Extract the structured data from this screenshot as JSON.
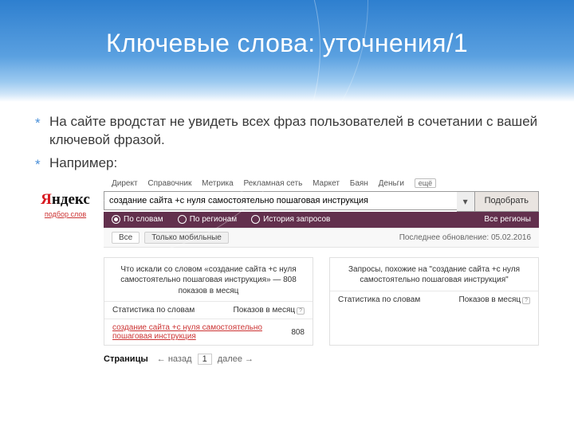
{
  "slide": {
    "title": "Ключевые слова: уточнения/1",
    "bullets": [
      "На сайте вродстат не увидеть всех фраз пользователей в сочетании с вашей ключевой фразой.",
      "Например:"
    ]
  },
  "ws": {
    "logo_red": "Я",
    "logo_rest": "ндекс",
    "logo_sub": "подбор слов",
    "nav": [
      "Директ",
      "Справочник",
      "Метрика",
      "Рекламная сеть",
      "Маркет",
      "Баян",
      "Деньги"
    ],
    "nav_more": "ещё",
    "search_value": "создание сайта +с нуля самостоятельно пошаговая инструкция",
    "search_btn": "Подобрать",
    "filters": {
      "words": "По словам",
      "regions": "По регионам",
      "history": "История запросов",
      "all_regions": "Все регионы"
    },
    "tabs": {
      "all": "Все",
      "mobile": "Только мобильные"
    },
    "updated": "Последнее обновление: 05.02.2016",
    "left_card": {
      "title": "Что искали со словом «создание сайта +с нуля самостоятельно пошаговая инструкция» — 808 показов в месяц",
      "stat_label": "Статистика по словам",
      "count_label": "Показов в месяц",
      "link": "создание сайта +с нуля самостоятельно пошаговая инструкция",
      "count": "808"
    },
    "right_card": {
      "title": "Запросы, похожие на \"создание сайта +с нуля самостоятельно пошаговая инструкция\"",
      "stat_label": "Статистика по словам",
      "count_label": "Показов в месяц"
    },
    "pager": {
      "label": "Страницы",
      "prev": "назад",
      "cur": "1",
      "next": "далее"
    }
  }
}
